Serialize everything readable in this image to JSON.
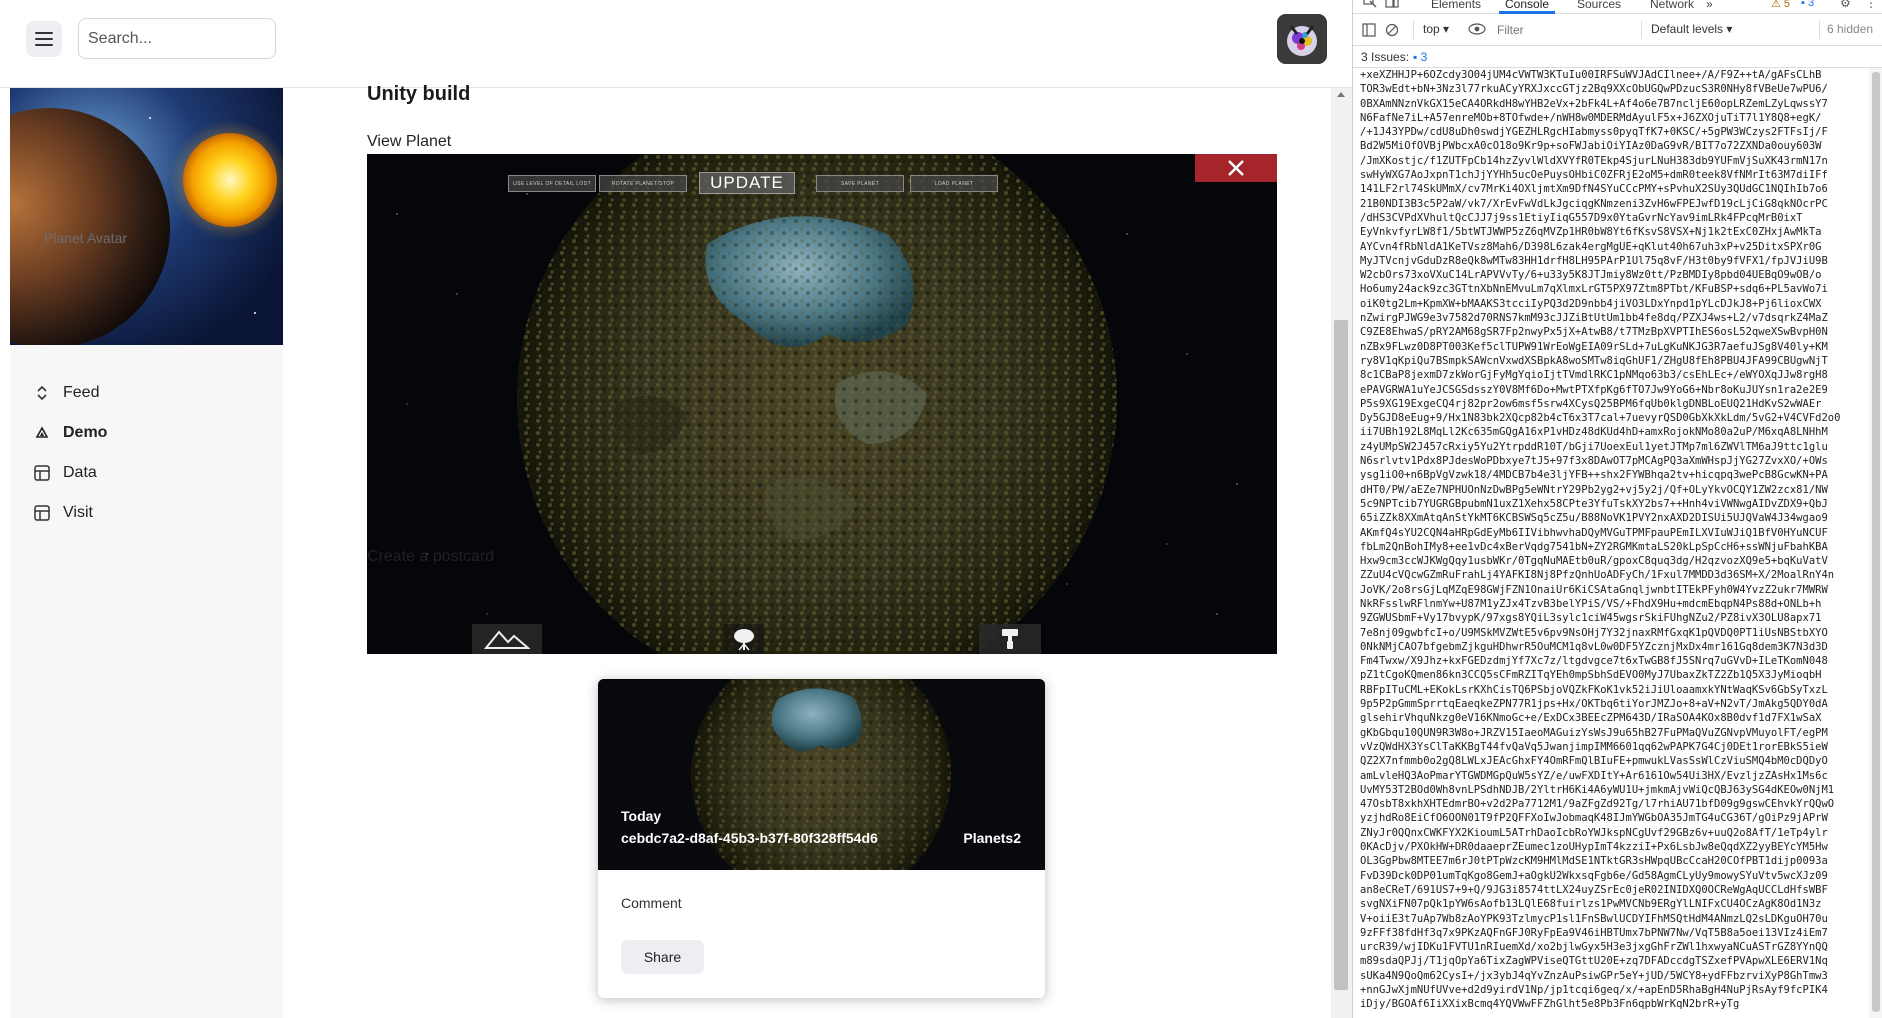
{
  "header": {
    "search_placeholder": "Search..."
  },
  "sidebar": {
    "avatar_alt": "Planet Avatar",
    "items": [
      {
        "label": "Feed",
        "icon": "chevron-up-down-icon",
        "active": false
      },
      {
        "label": "Demo",
        "icon": "triangle-icon",
        "active": true
      },
      {
        "label": "Data",
        "icon": "table-icon",
        "active": false
      },
      {
        "label": "Visit",
        "icon": "table-icon",
        "active": false
      }
    ]
  },
  "main": {
    "title": "Unity build",
    "view_label": "View Planet",
    "postcard_label": "Create a postcard"
  },
  "game": {
    "buttons": [
      "USE LEVEL OF DETAIL LOD?",
      "ROTATE PLANET/STOP",
      "UPDATE",
      "SAVE PLANET",
      "LOAD PLANET"
    ],
    "tools": [
      "mountain-icon",
      "tree-icon",
      "paint-roller-icon"
    ]
  },
  "postcard": {
    "date": "Today",
    "id": "cebdc7a2-d8af-45b3-b37f-80f328ff54d6",
    "planet": "Planets2",
    "comment_label": "Comment",
    "share_label": "Share"
  },
  "devtools": {
    "tabs": [
      "Elements",
      "Console",
      "Sources",
      "Network"
    ],
    "active_tab": "Console",
    "warnings": "5",
    "messages": "3",
    "context": "top",
    "filter_placeholder": "Filter",
    "levels": "Default levels",
    "hidden": "6 hidden",
    "issues_label": "3 Issues:",
    "issues_count": "3",
    "log_lines": [
      "+xeXZHHJP+6OZcdy3O04jUM4cVWTW3KTuIu00IRFSuWVJAdCIlnee+/A/F9Z++tA/gAFsCLhB",
      "TOR3wEdt+bN+3Nz3l77rkuACyYRXJxccGTjz2Bq9XXcObUGQwPDzucS3R0NHy8fVBeUe7wPU6/",
      "0BXAmNNznVkGX15eCA4ORkdH8wYHB2eVx+2bFk4L+Af4o6e7B7ncljE60opLRZemLZyLqwssY7",
      "N6FafNe7iL+A57enreMOb+8TOfwde+/nWH8w0MDERMdAyulF5x+J6ZXOjuTiT7l1Y8Q8+egK/",
      "/+1J43YPDw/cdU8uDh0swdjYGEZHLRgcHIabmyss0pyqTfK7+0KSC/+5gPW3WCzys2FTFsIj/F",
      "Bd2W5MiOfOVBjPWbcxA0cO18o9Kr9p+soFWJabiOiYIAz0DaG9vR/BIT7o72ZXNDa0ouy603W",
      "/JmXKostjc/f1ZUTFpCb14hzZyvlWldXVYfR0TEkp4SjurLNuH383db9YUFmVjSuXK43rmN17n",
      "swHyWXG7AoJxpnT1chJjYYHh5ucOePuysOHbiC0ZFRjE2oM5+dmR0teek8VfNMrIt63M7diIFf",
      "141LF2rl74SkUMmX/cv7MrKi4OXljmtXm9DfN4SYuCCcPMY+sPvhuX2SUy3QUdGC1NQIhIb7o6",
      "21B0NDI3B3c5P2aW/vk7/XrEvFwVdLkJgciqgKNmzeni3ZvH6wFPEJwfD19cLjCiG8qkNOcrPC",
      "/dHS3CVPdXVhultQcCJJ7j9ss1EtiyIiqG557D9x0YtaGvrNcYav9imLRk4FPcqMrB0ixT",
      "EyVnkvfyrLW8f1/5btWTJWWP5zZ6qMVZp1HR0bW8Yt6fKsvS8VSX+Nj1k2tExC0ZHxjAwMkTa",
      "AYCvn4fRbNldA1KeTVsz8Mah6/D398L6zak4ergMgUE+qKlut40h67uh3xP+v25DitxSPXr0G",
      "MyJTVcnjvGduDzR8eQk8wMTw83HH1drfH8LH95PArP1Ul75q8vF/H3t0by9fVFX1/fpJVJiU9B",
      "W2cbOrs73xoVXuC14LrAPVVvTy/6+u33y5K8JTJmiy8Wz0tt/PzBMDIy8pbd04UEBqO9wOB/o",
      "Ho6umy24ack9zc3GTtnXbNnEMvuLm7qXlmxLrGT5PX97Ztm8PTbt/KFuBSP+sdq6+PL5avWo7i",
      "oiK0tg2Lm+KpmXW+bMAAKS3tcciIyPQ3d2D9nbb4jiVO3LDxYnpd1pYLcDJkJ8+Pj6lioxCWX",
      "nZwirgPJWG9e3v7582d70RNS7kmM93cJJZiBtUtUm1bb4fe8dq/PZXJ4ws+L2/v7dsqrkZ4MaZ",
      "C9ZE8EhwaS/pRY2AM68gSR7Fp2nwyPx5jX+AtwB8/t7TMzBpXVPTIhES6osL52qweXSwBvpH0N",
      "nZBx9FLwz0D8PT003Kef5clTUPW91WrEoWgEIA09rSLd+7uLgKuNKJG3R7aefuJSg8V40ly+KM",
      "ry8V1qKpiQu7BSmpkSAWcnVxwdXSBpkA8woSMTw8iqGhUF1/ZHgU8fEh8PBU4JFA99CBUgwNjT",
      "8c1CBaP8jexmD7zkWorGjFyMgYqioIjtTVmdlRKC1pNMqo63b3/csEhLEc+/eWYOXqJJw8rgH8",
      "ePAVGRWA1uYeJCSGSdsszY0V8Mf6Do+MwtPTXfpKg6fTO7Jw9YoG6+Nbr8oKuJUYsn1ra2e2E9",
      "P5s9XG19ExgeCQ4rj82pr2ow6msf5srw4XCysQ25BPM6fqUb0klgDNBLoEUQ21HdKvS2wWAEr",
      "Dy5GJD8eEug+9/Hx1N83bk2XQcp82b4cT6x3T7cal+7uevyrQSD0GbXkXkLdm/5vG2+V4CVFd2o0",
      "ii7UBh192L8MqLl2Kc635mGQgA16xP1vHDz48dKUd4hD+amxRojokNMo80a2uP/M6xqA8LNHhM",
      "z4yUMpSW2J457cRxiy5Yu2YtrpddR10T/bGji7UoexEul1yetJTMp7ml6ZWVlTM6aJ9ttc1glu",
      "N6srlvtv1Pdx8PJdesWoPDbxye7tJ5+97f3x8DAwOT7pMCAgPQ3aXmWHspJjYG27ZvxXO/+OWs",
      "ysg1iO0+n6BpVgVzwk18/4MDCB7b4e3ljYFB++shx2FYWBhqa2tv+hicqpq3wePcB8GcwKN+PA",
      "dHT0/PW/aEZe7NPHUOnNzDwBPg5eWNtrY29Pb2yg2+vj5y2j/Qf+OLyYkvOCQY1ZW2zcx81/NW",
      "5c9NPTcib7YUGRGBpubmN1uxZ1Xehx58CPte3YfuTskXY2bs7++Hnh4viVWNwgAIDvZDX9+QbJ",
      "65iZZk8XXmAtqAnStYkMT6KCBSWSq5cZ5u/B88NoVK1PVY2nxAXD2DISUi5UJQVaW4J34wgao9",
      "AKmfQ4sYU2CQN4aHRpGdEyMb6IIVibhwvhaDQyMVGuTPMFpauPEmILXVIuWJiQ1BfV0HYuNCUF",
      "fbLm2QnBohIMy8+ee1vDc4xBerVqdg7541bN+ZY2RGMKmtaLS20kLpSpCcH6+ssWNjuFbahKBA",
      "Hxw9cm3ccWJKWgQqy1usbWKr/0TgqNuMAEtb0uR/gpoxC8quq3dg/H2qzvozXQ9e5+bqKuVatV",
      "ZZuU4cVQcwGZmRuFrahLj4YAFKI8Nj8PfzQnhUoADFyCh/1Fxul7MMDD3d36SM+X/2MoalRnY4n",
      "JoVK/2o8rsGjLqMZqE98GWjFZN1OnaiUr6KiCSAtaGnqljwnbtITEkPFyh0W4YvzZ2ukr7MWRW",
      "NkRFsslwRFlnmYw+U87M1yZJx4TzvB3belYPiS/VS/+FhdX9Hu+mdcmEbqpN4Ps88d+ONLb+h",
      "9ZGWUSbmF+Vy17bvypK/97xgs8YQiL3sylc1ciW45wgsrSkiFUhgNZu2/PZ8ivX3OLU8apx71",
      "7e8nj09gwbfcI+o/U9MSkMVZWtE5v6pv9NsOHj7Y32jnaxRMfGxqK1pQVDQ0PT1iUsNBStbXYO",
      "0NkNMjCAO7bfgebmZjkguHDhwrR5OuMCM1q8vL0w0DF5YZcznjMxDx4mr161Gq8dem3K7N3d3D",
      "Fm4Twxw/X9Jhz+kxFGEDzdmjYf7Xc7z/ltgdvgce7t6xTwGB8fJ5SNrq7uGVvD+ILeTKomN048",
      "pZ1tCgoKQmen86kn3CCQ5sCFmRZITqYEh0mpSbhSdEVO0MyJ7UbaxZkTZ2Zb1Q5X3JyMioqbH",
      "RBFpITuCML+EKokLsrKXhCisTQ6PSbjoVQZkFKoK1vk52iJiUloaamxkYNtWaqKSv6GbSyTxzL",
      "9p5P2pGmmSprrtqEaeqkeZPN77R1jps+Hx/OKTbq6tiYorJMZJo+8+aV+N2vT/JmAkg5QDY0dA",
      "glsehirVhquNkzg0eV16KNmoGc+e/ExDCx3BEEcZPM643D/IRaSOA4KOx8B0dvf1d7FX1wSaX",
      "gKbGbqu10QUN9R3W8o+JRZV15IaeoMAGuizYsWsJ9u65hB27FuPMaQVuZGNvpVMuyolFT/egPM",
      "vVzQWdHX3YsClTaKKBgT44fvQaVq5JwanjimpIMM6601qq62wPAPK7G4Cj0DEt1rorEBkS5ieW",
      "QZ2X7nfmmb0o2gQ8LWLxJEAcGhxFY4OmRFmQlBIuFE+pmwukLVasSsWlCzViuSMQ4bM0cDQDyO",
      "amLvleHQ3AoPmarYTGWDMGpQuW5sYZ/e/uwFXDItY+Ar6161Ow54Ui3HX/EvzljzZAsHx1Ms6c",
      "UvMY53T2BOd0Wh8vnLPSdhNDJB/2YltrH6Ki4A6yWU1U+jmkmAjvWiQcQBJ63ySG4dKEOw0NjM1",
      "47OsbT8xkhXHTEdmrBO+v2d2Pa7712M1/9aZFgZd92Tg/l7rhiAU71bfD09g9gswCEhvkYrQQwO",
      "yzjhdRo8EiCfO6OON01T9fP2QFFXoIwJobmaqK48IJmYWGbOA35JmTG4uCG36T/gOiPz9jAPrW",
      "ZNyJr0QQnxCWKFYX2KioumL5ATrhDaoIcbRoYWJkspNCgUvf29GBz6v+uuQ2o8AfT/1eTp4ylr",
      "0KAcDjv/PXOkHW+DR0daaeprZEumec1zoUHypImT4kzziI+Px6LsbJw8eQqdXZ2yyBEYcYM5Hw",
      "OL3GgPbw8MTEE7m6rJ0tPTpWzcKM9HMlMdSE1NTktGR3sHWpqUBcCcaH20COfPBT1dijp0093a",
      "FvD39Dck0DP01umTqKgo8GemJ+aOgkU2WkxsqFgb6e/Gd58AgmCLyUy9mowySYuVtv5wcXJz09",
      "an8eCReT/691US7+9+Q/9JG3i8574ttLX24uyZSrEc0jeR02INIDXQ0OCReWgAqUCCLdHfsWBF",
      "svgNXiFN07pQk1pYW6sAofb13LQlE68fuirlzs1PwMVCNb9ERgYlLNIFxCU4OCzAgK8Od1N3z",
      "V+oiiE3t7uAp7Wb8zAoYPK93TzlmycP1sl1FnSBwlUCDYIFhMSQtHdM4ANmzLQ2sLDKguOH70u",
      "9zFFf38fdHf3q7x9PKzAQFnGFJ0RyFpEa9V46iHBTUmx7bPNW7Nw/VqT5B8a5oei13VIz4iEm7",
      "urcR39/wjIDKu1FVTU1nRIuemXd/xo2bjlwGyx5H3e3jxgGhFrZWl1hxwyaNCuASTrGZ8YYnQQ",
      "m89sdaQPJj/T1jqOpYa6TixZagWPViseQTGttU20E+zq7DFADccdgTSZxefPVApwXLE6ERV1Nq",
      "sUKa4N9QoQm62CysI+/jx3ybJ4qYvZnzAuPsiwGPr5eY+jUD/5WCY8+ydFFbzrviXyP8GhTmw3",
      "+nnGJwXjmNUfUVve+d2d9yirdV1Np/jp1tcqi6geq/x/+apEnD5RhaBgH4NuPjRsAyf9fcPIK4",
      "iDjy/BGOAf6IiXXixBcmq4YQVWwFFZhGlht5e8Pb3Fn6qpbWrKqN2brR+yTg"
    ]
  }
}
